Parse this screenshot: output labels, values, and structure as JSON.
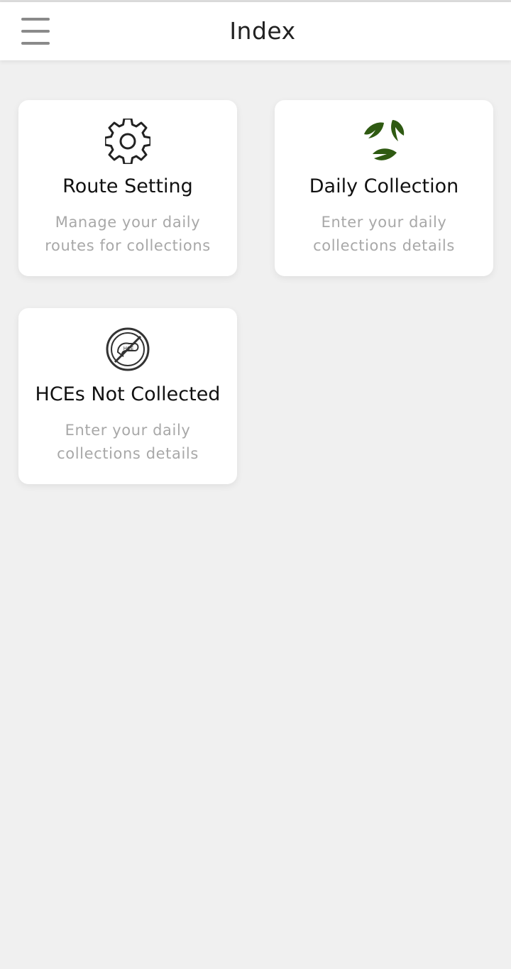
{
  "header": {
    "title": "Index",
    "menu_icon": "hamburger-menu-icon"
  },
  "cards": [
    {
      "title": "Route Setting",
      "description": "Manage your daily routes for collections",
      "icon": "gear-icon"
    },
    {
      "title": "Daily Collection",
      "description": "Enter your daily collections details",
      "icon": "leaves-icon",
      "icon_color": "#2f5a12"
    },
    {
      "title": "HCEs Not Collected",
      "description": "Enter your daily collections details",
      "icon": "hce-not-collected-icon",
      "icon_label": "HCE"
    }
  ],
  "colors": {
    "background": "#f0f0f0",
    "card": "#ffffff",
    "title_text": "#111111",
    "description_text": "#a8a8a8"
  }
}
